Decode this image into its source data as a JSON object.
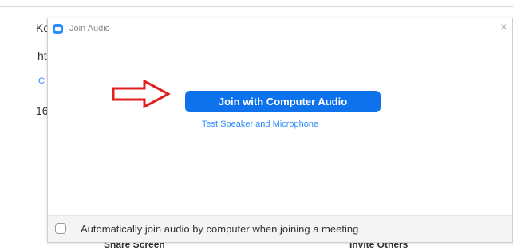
{
  "background": {
    "lines": [
      "Ko",
      "ht",
      "C",
      "16"
    ],
    "bottom_left_label": "Share Screen",
    "bottom_right_label": "Invite Others"
  },
  "dialog": {
    "title": "Join Audio",
    "close_icon": "×",
    "join_button_label": "Join with Computer Audio",
    "test_link": "Test Speaker and Microphone",
    "auto_join_label": "Automatically join audio by computer when joining a meeting",
    "auto_join_checked": false
  },
  "colors": {
    "accent": "#0e72ed",
    "link": "#2d8cff",
    "annotation_arrow": "#e02020"
  }
}
